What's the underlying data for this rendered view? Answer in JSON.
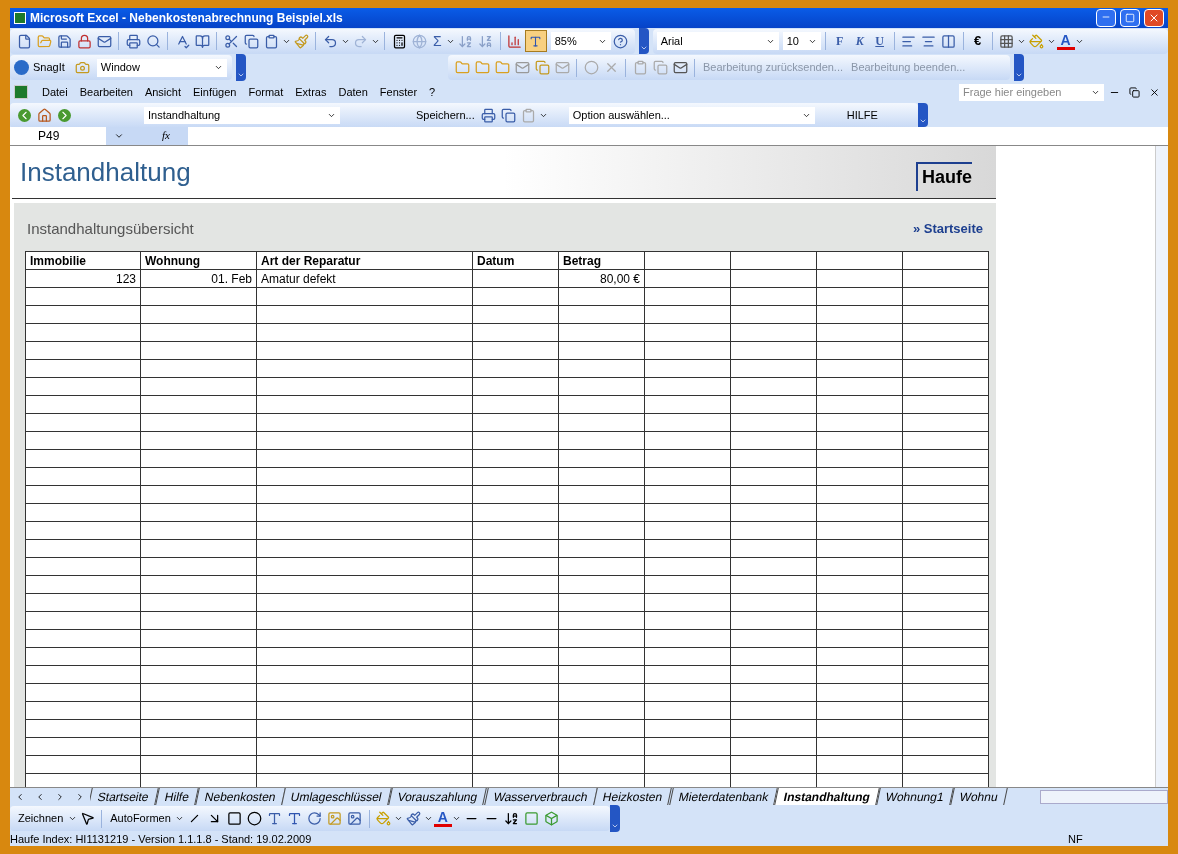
{
  "window": {
    "title": "Microsoft Excel - Nebenkostenabrechnung Beispiel.xls"
  },
  "standard_toolbar": {
    "sum": "Σ",
    "zoom": "85%"
  },
  "format_toolbar": {
    "font": "Arial",
    "size": "10",
    "bold": "F",
    "italic": "K",
    "underline": "U",
    "currency": "€",
    "font_color_letter": "A"
  },
  "snagit_toolbar": {
    "label": "SnagIt",
    "capture_mode": "Window"
  },
  "review_toolbar": {
    "items": [
      "Bearbeitung zurücksenden...",
      "Bearbeitung beenden..."
    ]
  },
  "menu": {
    "items": [
      "Datei",
      "Bearbeiten",
      "Ansicht",
      "Einfügen",
      "Format",
      "Extras",
      "Daten",
      "Fenster",
      "?"
    ],
    "help_placeholder": "Frage hier eingeben"
  },
  "nav_toolbar": {
    "sheet_select": "Instandhaltung",
    "save": "Speichern...",
    "option_select": "Option auswählen...",
    "help": "HILFE"
  },
  "formula_bar": {
    "cell": "P49",
    "fx": "fx"
  },
  "sheet": {
    "title": "Instandhaltung",
    "logo": "Haufe",
    "subtitle": "Instandhaltungsübersicht",
    "link": "» Startseite",
    "table": {
      "columns": [
        "Immobilie",
        "Wohnung",
        "Art der Reparatur",
        "Datum",
        "Betrag"
      ],
      "rows": [
        [
          "123",
          "01. Feb",
          "Amatur defekt",
          null,
          "80,00 €"
        ]
      ]
    }
  },
  "sheet_tabs": [
    {
      "label": "Startseite",
      "selected": false
    },
    {
      "label": "Hilfe",
      "selected": false
    },
    {
      "label": "Nebenkosten",
      "selected": false
    },
    {
      "label": "Umlageschlüssel",
      "selected": false
    },
    {
      "label": "Vorauszahlung",
      "selected": false
    },
    {
      "label": "Wasserverbrauch",
      "selected": false
    },
    {
      "label": "Heizkosten",
      "selected": false
    },
    {
      "label": "Mieterdatenbank",
      "selected": false
    },
    {
      "label": "Instandhaltung",
      "selected": true
    },
    {
      "label": "Wohnung1",
      "selected": false
    },
    {
      "label": "Wohnu",
      "selected": false
    }
  ],
  "drawing_toolbar": {
    "draw": "Zeichnen",
    "autoshapes": "AutoFormen",
    "font_color_letter": "A"
  },
  "status_bar": {
    "text": "Haufe Index: HI1131219 - Version 1.1.1.8 - Stand: 19.02.2009",
    "mode": "NF"
  }
}
